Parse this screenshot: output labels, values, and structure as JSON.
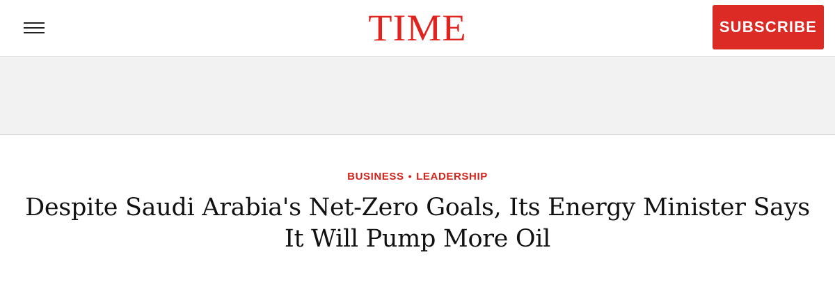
{
  "header": {
    "menu_icon": "hamburger-menu-icon",
    "logo_text": "TIME",
    "subscribe_label": "SUBSCRIBE",
    "brand_color": "#e0231f",
    "button_color": "#db2b24"
  },
  "article": {
    "categories": [
      "BUSINESS",
      "LEADERSHIP"
    ],
    "separator": "•",
    "headline": "Despite Saudi Arabia's Net-Zero Goals, Its Energy Minister Says It Will Pump More Oil"
  }
}
